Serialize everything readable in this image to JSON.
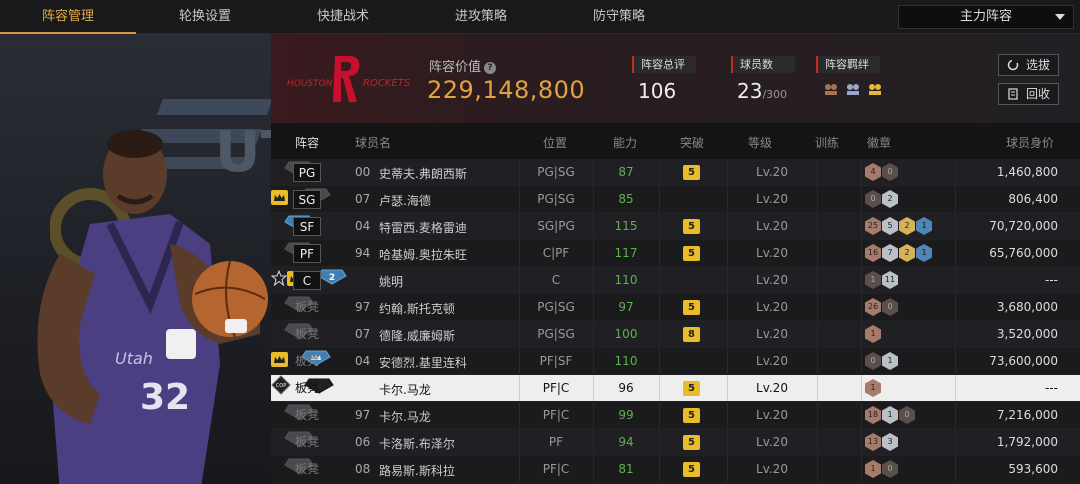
{
  "tabs": [
    {
      "label": "阵容管理",
      "active": true
    },
    {
      "label": "轮换设置",
      "active": false
    },
    {
      "label": "快捷战术",
      "active": false
    },
    {
      "label": "进攻策略",
      "active": false
    },
    {
      "label": "防守策略",
      "active": false
    }
  ],
  "lineup_select": {
    "value": "主力阵容"
  },
  "team": {
    "logo_text_left": "HOUSTON",
    "logo_text_right": "ROCKETS"
  },
  "lineup_value": {
    "label": "阵容价值",
    "value": "229,148,800"
  },
  "stats": {
    "rating_label": "阵容总评",
    "rating": "106",
    "players_label": "球员数",
    "players": "23",
    "players_max": "/300",
    "bond_label": "阵容羁绊"
  },
  "buttons": {
    "select": "选拔",
    "recycle": "回收"
  },
  "columns": [
    "阵容",
    "球员名",
    "位置",
    "能力",
    "突破",
    "等级",
    "训练",
    "徽章",
    "球员身价"
  ],
  "rows": [
    {
      "slot": "PG",
      "starter": true,
      "num": "00",
      "name": "史蒂夫.弗朗西斯",
      "pos": "PG|SG",
      "ability": "87",
      "break": "5",
      "level": "Lv.20",
      "train": "none",
      "badges": [
        {
          "t": "br",
          "v": "4"
        },
        {
          "t": "dk",
          "v": "0"
        }
      ],
      "price": "1,460,800"
    },
    {
      "slot": "SG",
      "starter": true,
      "num": "07",
      "name": "卢瑟.海德",
      "pos": "PG|SG",
      "ability": "85",
      "break": "crown",
      "level": "Lv.20",
      "train": "none",
      "badges": [
        {
          "t": "dk",
          "v": "0"
        },
        {
          "t": "sv",
          "v": "2"
        }
      ],
      "price": "806,400"
    },
    {
      "slot": "SF",
      "starter": true,
      "num": "04",
      "name": "特雷西.麦格雷迪",
      "pos": "SG|PG",
      "ability": "115",
      "break": "5",
      "level": "Lv.20",
      "train": "blue",
      "badges": [
        {
          "t": "br",
          "v": "25"
        },
        {
          "t": "sv",
          "v": "5"
        },
        {
          "t": "gd",
          "v": "2"
        },
        {
          "t": "bl",
          "v": "1"
        }
      ],
      "price": "70,720,000"
    },
    {
      "slot": "PF",
      "starter": true,
      "num": "94",
      "name": "哈基姆.奥拉朱旺",
      "pos": "C|PF",
      "ability": "117",
      "break": "5",
      "level": "Lv.20",
      "train": "none",
      "badges": [
        {
          "t": "br",
          "v": "16"
        },
        {
          "t": "sv",
          "v": "7"
        },
        {
          "t": "gd",
          "v": "2"
        },
        {
          "t": "bl",
          "v": "1"
        }
      ],
      "price": "65,760,000"
    },
    {
      "slot": "C",
      "starter": true,
      "num": "star",
      "name": "姚明",
      "pos": "C",
      "ability": "110",
      "break": "crown",
      "level": "Lv.20",
      "train": "blue2",
      "badges": [
        {
          "t": "dk",
          "v": "1"
        },
        {
          "t": "sv",
          "v": "11"
        }
      ],
      "price": "---"
    },
    {
      "slot": "板凳",
      "starter": false,
      "num": "97",
      "name": "约翰.斯托克顿",
      "pos": "PG|SG",
      "ability": "97",
      "break": "5",
      "level": "Lv.20",
      "train": "none",
      "badges": [
        {
          "t": "br",
          "v": "26"
        },
        {
          "t": "dk",
          "v": "0"
        }
      ],
      "price": "3,680,000"
    },
    {
      "slot": "板凳",
      "starter": false,
      "num": "07",
      "name": "德隆.威廉姆斯",
      "pos": "PG|SG",
      "ability": "100",
      "break": "8",
      "level": "Lv.20",
      "train": "none",
      "badges": [
        {
          "t": "br",
          "v": "1"
        }
      ],
      "price": "3,520,000"
    },
    {
      "slot": "板凳",
      "starter": false,
      "num": "04",
      "name": "安德烈.基里连科",
      "pos": "PF|SF",
      "ability": "110",
      "break": "crown",
      "level": "Lv.20",
      "train": "blue",
      "badges": [
        {
          "t": "dk",
          "v": "0"
        },
        {
          "t": "sv",
          "v": "1"
        }
      ],
      "price": "73,600,000"
    },
    {
      "slot": "板凳",
      "starter": false,
      "num": "cop",
      "name": "卡尔.马龙",
      "pos": "PF|C",
      "ability": "96",
      "break": "5",
      "level": "Lv.20",
      "train": "dark",
      "badges": [
        {
          "t": "br",
          "v": "1"
        }
      ],
      "price": "---",
      "selected": true
    },
    {
      "slot": "板凳",
      "starter": false,
      "num": "97",
      "name": "卡尔.马龙",
      "pos": "PF|C",
      "ability": "99",
      "break": "5",
      "level": "Lv.20",
      "train": "none",
      "badges": [
        {
          "t": "br",
          "v": "18"
        },
        {
          "t": "sv",
          "v": "1"
        },
        {
          "t": "dk",
          "v": "0"
        }
      ],
      "price": "7,216,000"
    },
    {
      "slot": "板凳",
      "starter": false,
      "num": "06",
      "name": "卡洛斯.布泽尔",
      "pos": "PF",
      "ability": "94",
      "break": "5",
      "level": "Lv.20",
      "train": "none",
      "badges": [
        {
          "t": "br",
          "v": "13"
        },
        {
          "t": "sv",
          "v": "3"
        }
      ],
      "price": "1,792,000"
    },
    {
      "slot": "板凳",
      "starter": false,
      "num": "08",
      "name": "路易斯.斯科拉",
      "pos": "PF|C",
      "ability": "81",
      "break": "5",
      "level": "Lv.20",
      "train": "none",
      "badges": [
        {
          "t": "br",
          "v": "1"
        },
        {
          "t": "dk",
          "v": "0"
        }
      ],
      "price": "593,600"
    }
  ],
  "colors": {
    "accent": "#e3a23e",
    "ability": "#5fb04f",
    "tab_active": "#d9963a"
  }
}
